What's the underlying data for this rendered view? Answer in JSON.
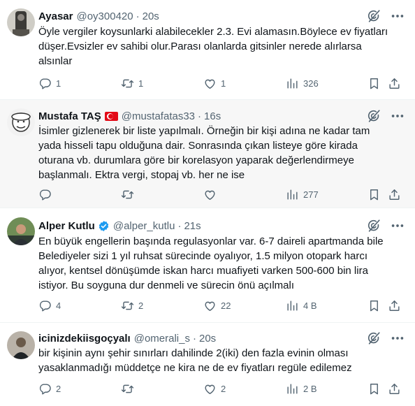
{
  "tweets": [
    {
      "name": "Ayasar",
      "handle": "@oy300420",
      "time": "20s",
      "flag": false,
      "verified": false,
      "lines": [
        "Öyle vergiler koysunlarki alabilecekler 2.3. Evi alamasın.Böylece ev fiyatları",
        "düşer.Evsizler ev sahibi olur.Parası olanlarda gitsinler nerede alırlarsa",
        "alsınlar"
      ],
      "stats": {
        "replies": "1",
        "reposts": "1",
        "likes": "1",
        "views": "326"
      }
    },
    {
      "name": "Mustafa TAŞ",
      "handle": "@mustafatas33",
      "time": "16s",
      "flag": true,
      "verified": false,
      "lines": [
        "İsimler gizlenerek bir liste yapılmalı. Örneğin bir kişi adına ne kadar tam",
        "yada hisseli tapu olduğuna dair. Sonrasında çıkan listeye göre kirada",
        "oturana vb. durumlara göre bir korelasyon yaparak değerlendirmeye",
        "başlanmalı. Ektra vergi, stopaj vb. her ne ise"
      ],
      "stats": {
        "replies": "",
        "reposts": "",
        "likes": "",
        "views": "277"
      }
    },
    {
      "name": "Alper Kutlu",
      "handle": "@alper_kutlu",
      "time": "21s",
      "flag": false,
      "verified": true,
      "lines": [
        "En büyük engellerin başında regulasyonlar var. 6-7 daireli apartmanda bile",
        "Belediyeler sizi 1 yıl ruhsat sürecinde oyalıyor, 1.5 milyon otopark harcı",
        "alıyor, kentsel dönüşümde iskan harcı muafiyeti varken 500-600 bin lira",
        "istiyor. Bu soyguna dur denmeli ve sürecin önü açılmalı"
      ],
      "stats": {
        "replies": "4",
        "reposts": "2",
        "likes": "22",
        "views": "4 B"
      }
    },
    {
      "name": "icinizdekiisgoçyalı",
      "handle": "@omerali_s",
      "time": "20s",
      "flag": false,
      "verified": false,
      "lines": [
        "bir kişinin aynı şehir sınırları dahilinde 2(iki) den fazla evinin olması",
        "yasaklanmadığı müddetçe ne kira ne de ev fiyatları regüle edilemez"
      ],
      "stats": {
        "replies": "2",
        "reposts": "",
        "likes": "2",
        "views": "2 B"
      }
    }
  ],
  "colors": {
    "text": "#0f1419",
    "secondary": "#536471",
    "verified": "#1d9bf0",
    "flag": "#e30a17",
    "divider": "#eff3f4",
    "highlight_bg": "#f7f7f7"
  },
  "icons": [
    "grok-icon",
    "more-icon",
    "reply-icon",
    "repost-icon",
    "like-icon",
    "views-icon",
    "bookmark-icon",
    "share-icon",
    "verified-icon"
  ]
}
